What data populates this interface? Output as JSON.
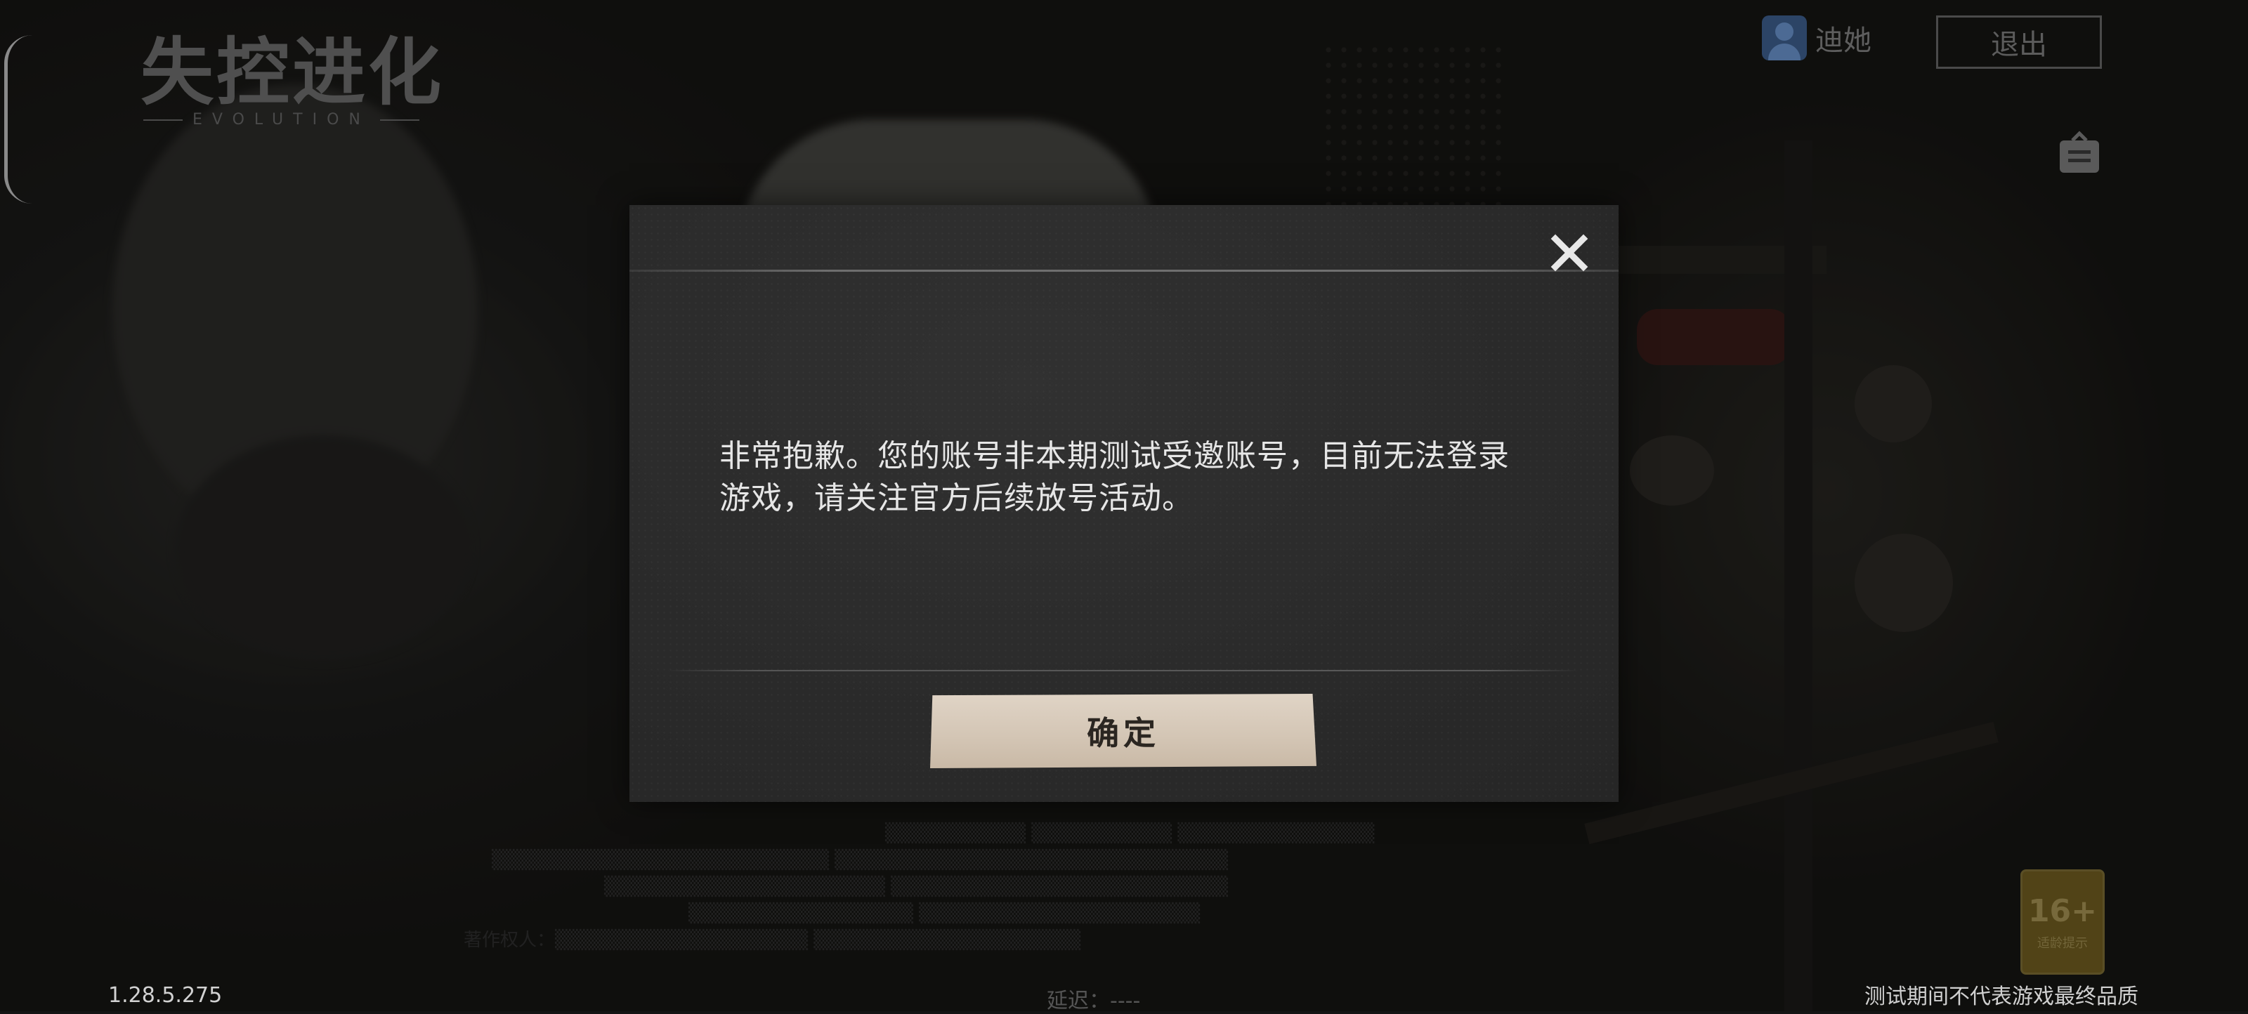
{
  "logo": {
    "title": "失控进化",
    "subtitle": "EVOLUTION"
  },
  "user": {
    "name": "迪她",
    "exit_label": "退出"
  },
  "dialog": {
    "message": "非常抱歉。您的账号非本期测试受邀账号，目前无法登录游戏，请关注官方后续放号活动。",
    "confirm_label": "确定"
  },
  "footer": {
    "version": "1.28.5.275",
    "latency": "延迟：----",
    "disclaimer": "测试期间不代表游戏最终品质"
  },
  "age_rating": {
    "label": "16+",
    "caption": "适龄提示"
  },
  "background_legal_text": {
    "copyright_label": "著作权人："
  },
  "colors": {
    "dialog_bg": "#2b2b2b",
    "confirm_button": "#d3c5b4",
    "message_text": "#e6e6e6"
  },
  "icons": {
    "close": "close-icon",
    "notice": "notice-board-icon",
    "avatar": "user-avatar-icon"
  }
}
